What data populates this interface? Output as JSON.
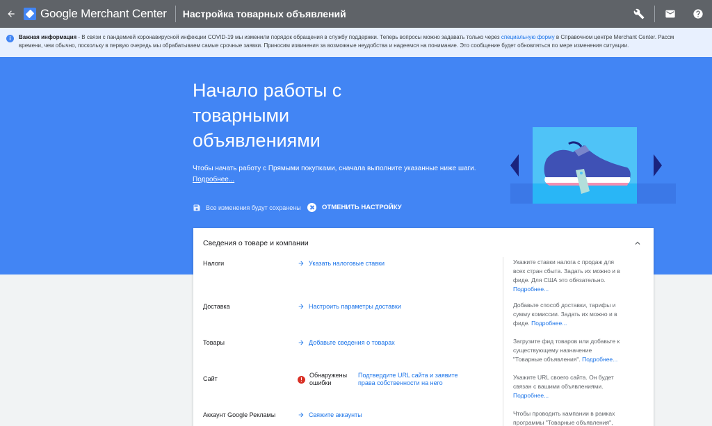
{
  "app": {
    "brand": "Google Merchant Center",
    "page_title": "Настройка товарных объявлений"
  },
  "banner": {
    "bold": "Важная информация",
    "text_before": " - В связи с пандемией коронавирусной инфекции COVID-19 мы изменили порядок обращения в службу поддержки. Теперь вопросы можно задавать только через ",
    "link": "специальную форму",
    "text_after": " в Справочном центре Merchant Center. Рассм",
    "line2": "времени, чем обычно, поскольку в первую очередь мы обрабатываем самые срочные заявки. Приносим извинения за возможные неудобства и надеемся на понимание. Это сообщение будет обновляться по мере изменения ситуации."
  },
  "hero": {
    "title": "Начало работы с товарными объявлениями",
    "desc": "Чтобы начать работу с Прямыми покупками, сначала выполните указанные ниже шаги.",
    "more": "Подробнее...",
    "save_text": "Все изменения будут сохранены",
    "cancel_label": "ОТМЕНИТЬ НАСТРОЙКУ"
  },
  "card": {
    "header": "Сведения о товаре и компании",
    "rows": [
      {
        "label": "Налоги",
        "action": "Указать налоговые ставки",
        "help": "Укажите ставки налога с продаж для всех стран сбыта. Задать их можно и в фиде. Для США это обязательно.",
        "help_link": "Подробнее..."
      },
      {
        "label": "Доставка",
        "action": "Настроить параметры доставки",
        "help": "Добавьте способ доставки, тарифы и сумму комиссии. Задать их можно и в фиде.",
        "help_link": "Подробнее..."
      },
      {
        "label": "Товары",
        "action": "Добавьте сведения о товарах",
        "help": "Загрузите фид товаров или добавьте к существующему назначение \"Товарные объявления\".",
        "help_link": "Подробнее..."
      },
      {
        "label": "Сайт",
        "error_text": "Обнаружены ошибки",
        "action": "Подтвердите URL сайта и заявите права собственности на него",
        "help": "Укажите URL своего сайта. Он будет связан с вашими объявлениями.",
        "help_link": "Подробнее..."
      },
      {
        "label": "Аккаунт Google Рекламы",
        "action": "Свяжите аккаунты",
        "help": "Чтобы проводить кампании в рамках программы \"Товарные объявления\",",
        "help_link": ""
      }
    ]
  },
  "colors": {
    "topbar": "#5f6368",
    "hero": "#4285f4",
    "link": "#1a73e8",
    "error": "#d93025"
  }
}
